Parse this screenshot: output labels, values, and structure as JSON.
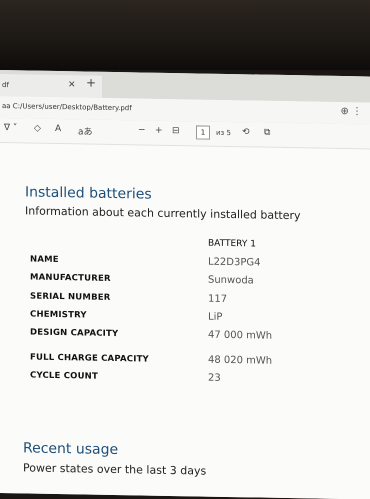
{
  "browser": {
    "tab_title": "df",
    "url": "aa C:/Users/user/Desktop/Battery.pdf"
  },
  "toolbar": {
    "text_size": "A",
    "read_aloud": "aあ",
    "zoom_out": "−",
    "zoom_in": "+",
    "page_number": "1",
    "page_total": "из 5"
  },
  "report": {
    "section_title": "Installed batteries",
    "section_subtitle": "Information about each currently installed battery",
    "column_header": "BATTERY 1",
    "rows": [
      {
        "label": "NAME",
        "value": "L22D3PG4"
      },
      {
        "label": "MANUFACTURER",
        "value": "Sunwoda"
      },
      {
        "label": "SERIAL NUMBER",
        "value": "117"
      },
      {
        "label": "CHEMISTRY",
        "value": "LiP"
      },
      {
        "label": "DESIGN CAPACITY",
        "value": "47 000 mWh"
      },
      {
        "label": "FULL CHARGE CAPACITY",
        "value": "48 020 mWh"
      },
      {
        "label": "CYCLE COUNT",
        "value": "23"
      }
    ],
    "usage_title": "Recent usage",
    "usage_subtitle": "Power states over the last 3 days"
  }
}
